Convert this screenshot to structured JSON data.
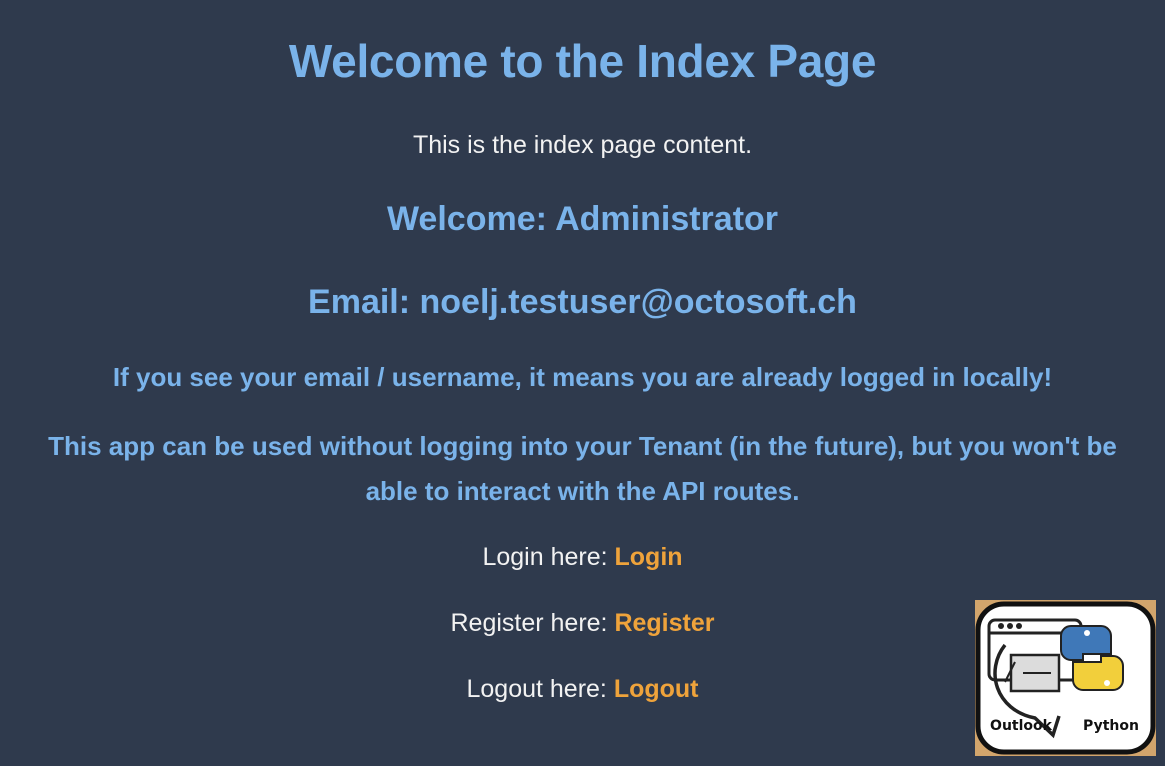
{
  "header": {
    "title": "Welcome to the Index Page",
    "intro": "This is the index page content."
  },
  "user": {
    "welcome": "Welcome: Administrator",
    "email": "Email: noelj.testuser@octosoft.ch"
  },
  "notices": {
    "logged_in": "If you see your email / username, it means you are already logged in locally!",
    "tenant": "This app can be used without logging into your Tenant (in the future), but you won't be able to interact with the API routes."
  },
  "links": {
    "login_prefix": "Login here: ",
    "login_label": "Login",
    "register_prefix": "Register here: ",
    "register_label": "Register",
    "logout_prefix": "Logout here: ",
    "logout_label": "Logout"
  },
  "logo": {
    "left_text": "Outlook",
    "right_text": "Python",
    "icon": "outlook-python-logo"
  },
  "colors": {
    "background": "#2f3a4d",
    "heading": "#7ab3ea",
    "text": "#f2f2f2",
    "link": "#efa33b"
  }
}
